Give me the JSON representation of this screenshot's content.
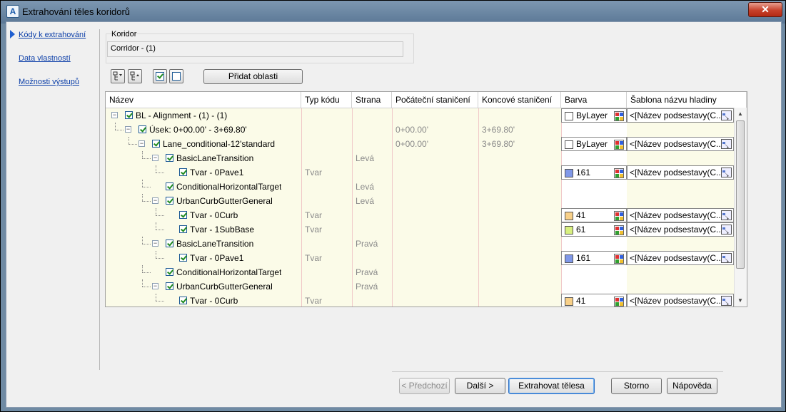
{
  "window": {
    "title": "Extrahování těles koridorů",
    "close": "✕"
  },
  "nav": {
    "items": [
      {
        "label": "Kódy k extrahování",
        "active": true
      },
      {
        "label": "Data vlastností",
        "active": false
      },
      {
        "label": "Možnosti výstupů",
        "active": false
      }
    ]
  },
  "corridor": {
    "group_label": "Koridor",
    "value": "Corridor - (1)"
  },
  "toolbar": {
    "add_regions": "Přidat oblasti"
  },
  "grid": {
    "headers": [
      "Název",
      "Typ kódu",
      "Strana",
      "Počáteční staničení",
      "Koncové staničení",
      "Barva",
      "Šablona názvu hladiny"
    ],
    "rows": [
      {
        "name": "BL - Alignment - (1) - (1)",
        "type": "",
        "side": "",
        "start": "",
        "end": "",
        "color": "ByLayer",
        "color_hex": "#ffffff",
        "template": "<[Název podsestavy(C..."
      },
      {
        "name": "Úsek: 0+00.00' - 3+69.80'",
        "type": "",
        "side": "",
        "start": "0+00.00'",
        "end": "3+69.80'",
        "color": "",
        "color_hex": "",
        "template": ""
      },
      {
        "name": "Lane_conditional-12'standard",
        "type": "",
        "side": "",
        "start": "0+00.00'",
        "end": "3+69.80'",
        "color": "ByLayer",
        "color_hex": "#ffffff",
        "template": "<[Název podsestavy(C..."
      },
      {
        "name": "BasicLaneTransition",
        "type": "",
        "side": "Levá",
        "start": "",
        "end": "",
        "color": "",
        "color_hex": "",
        "template": ""
      },
      {
        "name": "Tvar - 0Pave1",
        "type": "Tvar",
        "side": "",
        "start": "",
        "end": "",
        "color": "161",
        "color_hex": "#8098e8",
        "template": "<[Název podsestavy(C..."
      },
      {
        "name": "ConditionalHorizontalTarget",
        "type": "",
        "side": "Levá",
        "start": "",
        "end": "",
        "color": "",
        "color_hex": "",
        "template": ""
      },
      {
        "name": "UrbanCurbGutterGeneral",
        "type": "",
        "side": "Levá",
        "start": "",
        "end": "",
        "color": "",
        "color_hex": "",
        "template": ""
      },
      {
        "name": "Tvar - 0Curb",
        "type": "Tvar",
        "side": "",
        "start": "",
        "end": "",
        "color": "41",
        "color_hex": "#f8d088",
        "template": "<[Název podsestavy(C..."
      },
      {
        "name": "Tvar - 1SubBase",
        "type": "Tvar",
        "side": "",
        "start": "",
        "end": "",
        "color": "61",
        "color_hex": "#d8f080",
        "template": "<[Název podsestavy(C..."
      },
      {
        "name": "BasicLaneTransition",
        "type": "",
        "side": "Pravá",
        "start": "",
        "end": "",
        "color": "",
        "color_hex": "",
        "template": ""
      },
      {
        "name": "Tvar - 0Pave1",
        "type": "Tvar",
        "side": "",
        "start": "",
        "end": "",
        "color": "161",
        "color_hex": "#8098e8",
        "template": "<[Název podsestavy(C..."
      },
      {
        "name": "ConditionalHorizontalTarget",
        "type": "",
        "side": "Pravá",
        "start": "",
        "end": "",
        "color": "",
        "color_hex": "",
        "template": ""
      },
      {
        "name": "UrbanCurbGutterGeneral",
        "type": "",
        "side": "Pravá",
        "start": "",
        "end": "",
        "color": "",
        "color_hex": "",
        "template": ""
      },
      {
        "name": "Tvar - 0Curb",
        "type": "Tvar",
        "side": "",
        "start": "",
        "end": "",
        "color": "41",
        "color_hex": "#f8d088",
        "template": "<[Název podsestavy(C..."
      }
    ]
  },
  "footer": {
    "prev": "< Předchozí",
    "next": "Další >",
    "extract": "Extrahovat tělesa",
    "cancel": "Storno",
    "help": "Nápověda"
  }
}
